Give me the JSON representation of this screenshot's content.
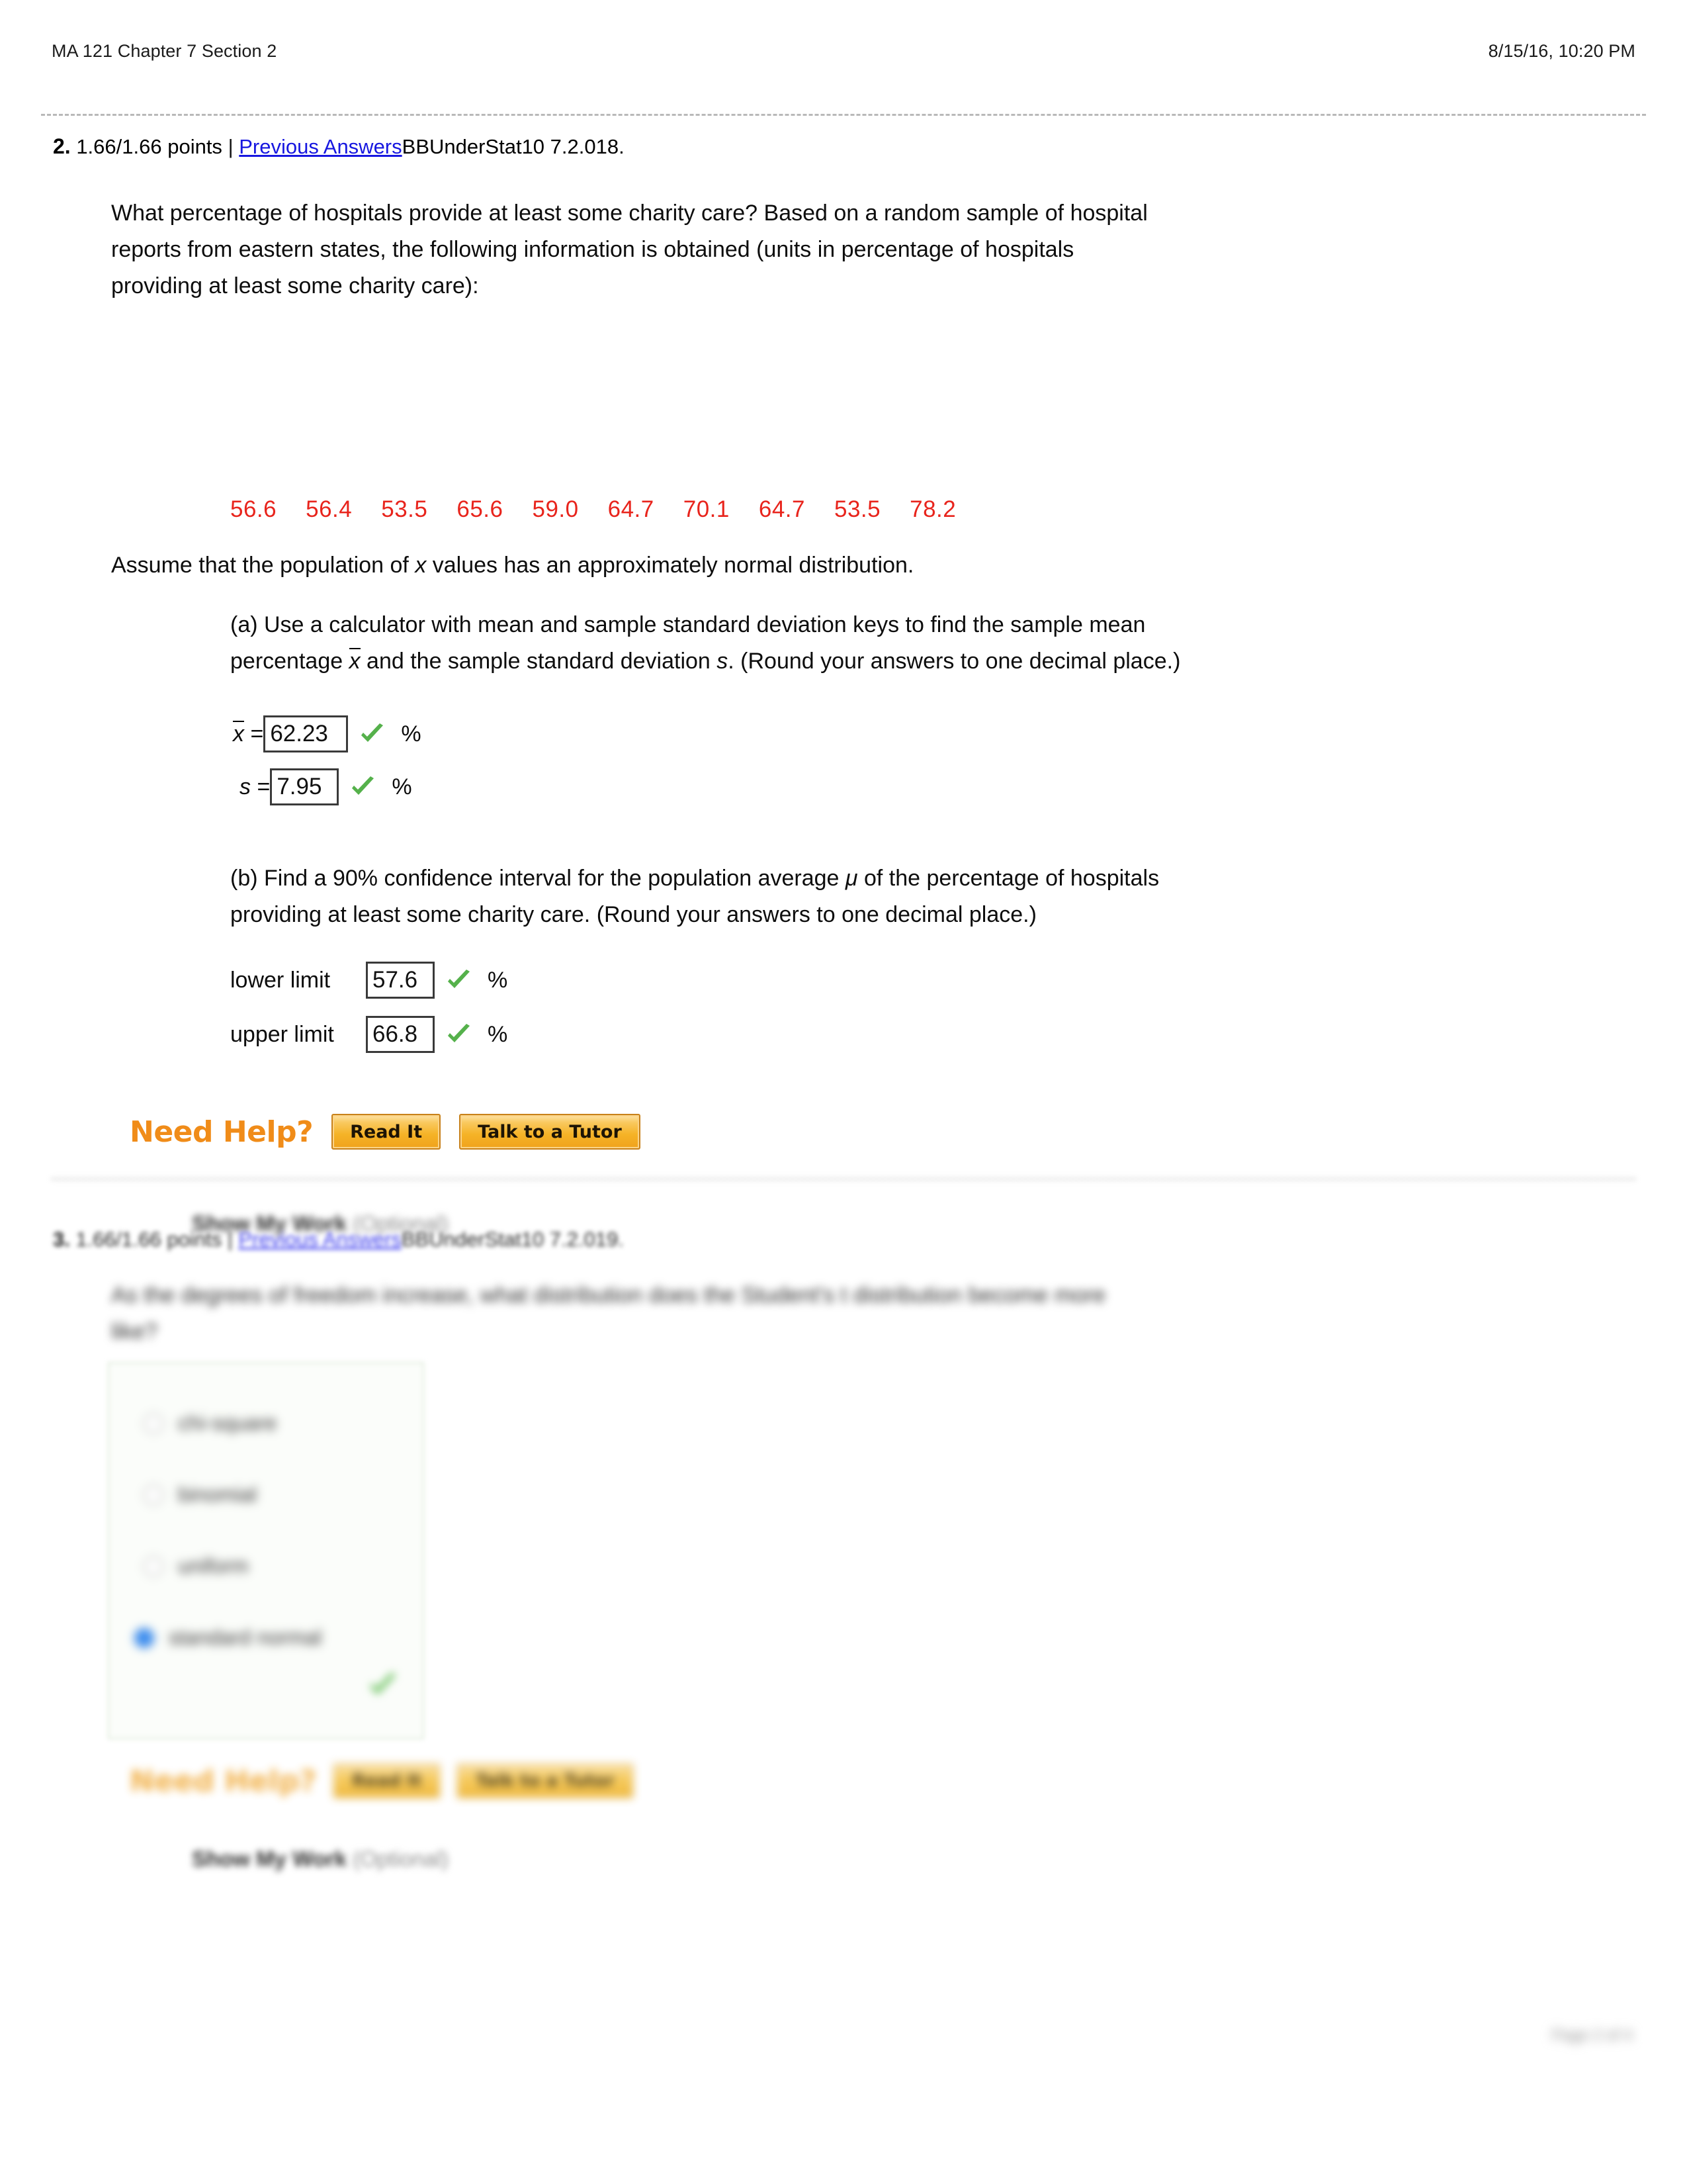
{
  "header": {
    "title": "MA 121 Chapter 7 Section 2",
    "timestamp": "8/15/16, 10:20 PM"
  },
  "question2": {
    "number": "2.",
    "points": "1.66/1.66 points",
    "separator": "|",
    "previous_answers_link": "Previous Answers",
    "problem_code": "BBUnderStat10 7.2.018.",
    "prompt_line1": "What percentage of hospitals provide at least some charity care? Based on a random sample of hospital",
    "prompt_line2": "reports from eastern states, the following information is obtained (units in percentage of hospitals",
    "prompt_line3": "providing at least some charity care):",
    "data_values": [
      "56.6",
      "56.4",
      "53.5",
      "65.6",
      "59.0",
      "64.7",
      "70.1",
      "64.7",
      "53.5",
      "78.2"
    ],
    "data_color": "#e8241c",
    "assume_pre": "Assume that the population of ",
    "assume_var": "x",
    "assume_post": " values has an approximately normal distribution.",
    "part_a": {
      "label_line1_pre": "(a) Use a calculator with mean and sample standard deviation keys to find the sample mean",
      "label_line2_pre": "percentage ",
      "label_line2_var1": "x",
      "label_line2_mid": " and the sample standard deviation ",
      "label_line2_var2": "s",
      "label_line2_post": ". (Round your answers to one decimal place.)",
      "mean_symbol": "x",
      "mean_eq": " = ",
      "mean_value": "62.23",
      "mean_unit": "%",
      "sd_symbol": "s",
      "sd_eq": " = ",
      "sd_value": "7.95",
      "sd_unit": "%",
      "mean_status": "correct",
      "sd_status": "correct"
    },
    "part_b": {
      "label_line1_pre": "(b) Find a 90% confidence interval for the population average ",
      "label_line1_mu": "μ",
      "label_line1_post": " of the percentage of hospitals",
      "label_line2": "providing at least some charity care. (Round your answers to one decimal place.)",
      "lower_label": "lower limit",
      "lower_value": "57.6",
      "lower_unit": "%",
      "upper_label": "upper limit",
      "upper_value": "66.8",
      "upper_unit": "%",
      "lower_status": "correct",
      "upper_status": "correct"
    },
    "need_help": {
      "title": "Need Help?",
      "read_it": "Read It",
      "talk_tutor": "Talk to a Tutor",
      "accent_color": "#f08c19"
    },
    "show_my_work": {
      "label": "Show My Work",
      "optional": "(Optional)"
    }
  },
  "question3": {
    "number": "3.",
    "points": "1.66/1.66 points",
    "separator": "|",
    "previous_answers_link": "Previous Answers",
    "problem_code": "BBUnderStat10 7.2.019.",
    "prompt_line1": "As the degrees of freedom increase, what distribution does the Student's t distribution become more",
    "prompt_line2": "like?",
    "choices": [
      {
        "label": "chi-square",
        "selected": false
      },
      {
        "label": "binomial",
        "selected": false
      },
      {
        "label": "uniform",
        "selected": false
      },
      {
        "label": "standard normal",
        "selected": true
      }
    ],
    "answer_status": "correct",
    "need_help": {
      "title": "Need Help?",
      "read_it": "Read It",
      "talk_tutor": "Talk to a Tutor"
    },
    "show_my_work": {
      "label": "Show My Work",
      "optional": "(Optional)"
    }
  },
  "footer": {
    "left": "",
    "right": "Page 2 of 4"
  }
}
